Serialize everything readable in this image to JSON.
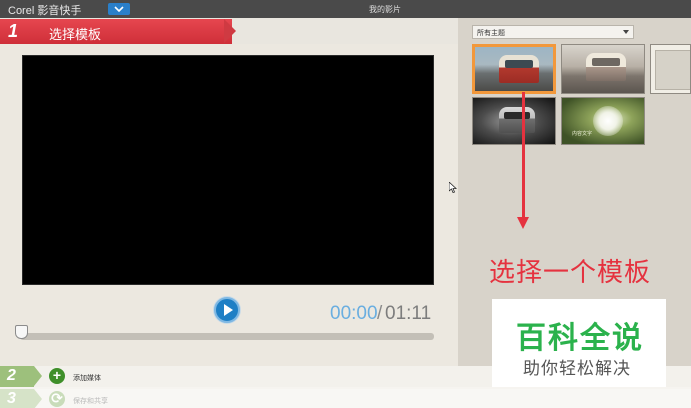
{
  "titlebar": {
    "app_name": "Corel 影音快手",
    "window_title": "我的影片"
  },
  "step1": {
    "number": "1",
    "label": "选择模板"
  },
  "player": {
    "current_time": "00:00",
    "separator": "/",
    "total_time": "01:11",
    "progress": 0
  },
  "themes": {
    "filter_value": "所有主题",
    "thumbnails": [
      {
        "name": "van-orange",
        "selected": true
      },
      {
        "name": "van-sepia",
        "selected": false
      },
      {
        "name": "frame-partial",
        "selected": false
      },
      {
        "name": "van-bw",
        "selected": false
      },
      {
        "name": "dandelion",
        "selected": false,
        "caption": "内容文字"
      }
    ]
  },
  "annotation": {
    "text": "选择一个模板"
  },
  "watermark": {
    "title": "百科全说",
    "subtitle": "助你轻松解决"
  },
  "steps": [
    {
      "number": "2",
      "label": "添加媒体",
      "icon": "add-icon",
      "enabled": true
    },
    {
      "number": "3",
      "label": "保存和共享",
      "icon": "share-icon",
      "enabled": false
    }
  ],
  "colors": {
    "step1_red": "#d9383f",
    "accent_blue": "#1e7fc5",
    "annotation_red": "#e5323f",
    "selection_orange": "#f2983b",
    "watermark_green": "#2bb24c"
  }
}
